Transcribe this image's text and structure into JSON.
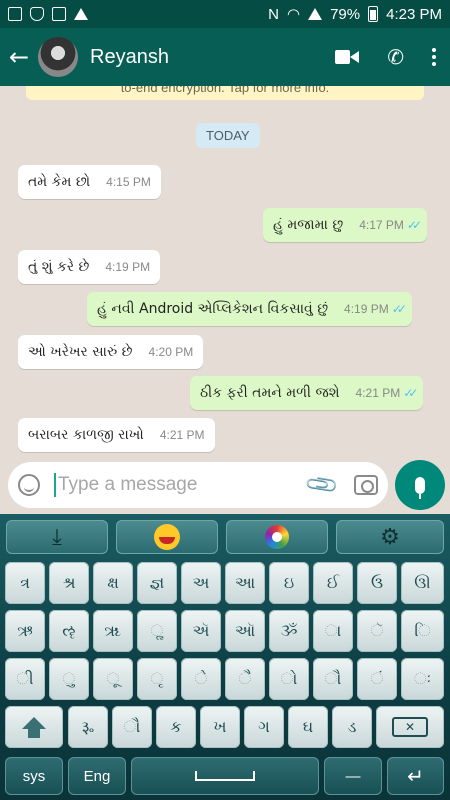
{
  "status_bar": {
    "battery": "79%",
    "time": "4:23 PM"
  },
  "header": {
    "contact_name": "Reyansh"
  },
  "chat": {
    "encryption_notice": "to-end encryption. Tap for more info.",
    "date_divider": "TODAY",
    "messages": [
      {
        "direction": "in",
        "text": "તમે કેમ છો",
        "time": "4:15 PM"
      },
      {
        "direction": "out",
        "text": "હું મજામા છુ",
        "time": "4:17 PM",
        "status": "read"
      },
      {
        "direction": "in",
        "text": "તું શું કરે છે",
        "time": "4:19 PM"
      },
      {
        "direction": "out",
        "text": "હું નવી Android એપ્લિકેશન વિકસાવું છું",
        "time": "4:19 PM",
        "status": "read"
      },
      {
        "direction": "in",
        "text": "ઓ ખરેખર સારું છે",
        "time": "4:20 PM"
      },
      {
        "direction": "out",
        "text": "ઠીક ફરી તમને મળી જશે",
        "time": "4:21 PM",
        "status": "read"
      },
      {
        "direction": "in",
        "text": "બરાબર કાળજી રાખો",
        "time": "4:21 PM"
      }
    ]
  },
  "composer": {
    "placeholder": "Type a message"
  },
  "keyboard": {
    "row1": [
      "ત્ર",
      "શ્ર",
      "ક્ષ",
      "જ્ઞ",
      "અ",
      "આ",
      "ઇ",
      "ઈ",
      "ઉ",
      "ઊ"
    ],
    "row2": [
      "ઋ",
      "ૡ",
      "ૠ",
      "ૢ",
      "ઍ",
      "ઑ",
      "ૐ",
      "ા",
      "ૅ",
      "િ"
    ],
    "row3": [
      "ી",
      "ુ",
      "ૂ",
      "ૃ",
      "ે",
      "ૈ",
      "ો",
      "ૌ",
      "ં",
      "ઃ"
    ],
    "row4": [
      "૱",
      "ૌ",
      "ક",
      "ખ",
      "ગ",
      "ઘ",
      "ડ"
    ],
    "sys_label": "sys",
    "eng_label": "Eng",
    "enter_label": "↵",
    "dash_label": "—"
  },
  "colors": {
    "header": "#075e54",
    "statusbar": "#054d44",
    "outgoing_bubble": "#dcf8c6",
    "incoming_bubble": "#ffffff",
    "read_ticks": "#4fc3f7",
    "mic_button": "#00897b"
  }
}
